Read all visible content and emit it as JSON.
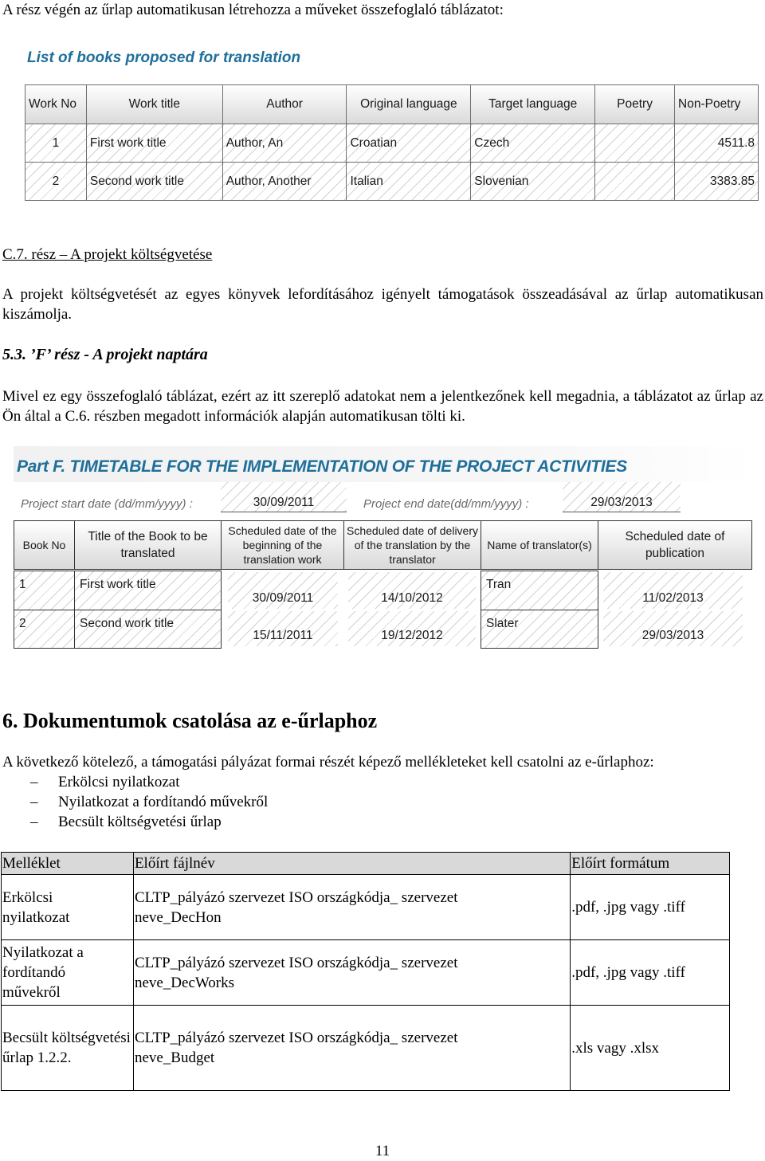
{
  "intro_line": "A rész végén az űrlap automatikusan létrehozza a műveket összefoglaló táblázatot:",
  "books_table": {
    "title": "List of books proposed for translation",
    "headers": [
      "Work No",
      "Work title",
      "Author",
      "Original language",
      "Target language",
      "Poetry",
      "Non-Poetry"
    ],
    "rows": [
      [
        "1",
        "First work title",
        "Author, An",
        "Croatian",
        "Czech",
        "",
        "4511.8"
      ],
      [
        "2",
        "Second work title",
        "Author, Another",
        "Italian",
        "Slovenian",
        "",
        "3383.85"
      ]
    ]
  },
  "section_c7": {
    "heading": "C.7. rész – A projekt költségvetése",
    "paragraph": "A projekt költségvetését az egyes könyvek lefordításához igényelt támogatások összeadásával az űrlap automatikusan kiszámolja."
  },
  "section_53": {
    "heading": "5.3. ’F’ rész - A projekt naptára",
    "paragraph": "Mivel ez egy összefoglaló táblázat, ezért az itt szereplő adatokat nem a jelentkezőnek kell megadnia, a táblázatot az űrlap az Ön által a C.6. részben megadott információk alapján automatikusan tölti ki."
  },
  "timetable": {
    "title": "Part F. TIMETABLE FOR THE IMPLEMENTATION OF THE PROJECT ACTIVITIES",
    "start_label": "Project start date (dd/mm/yyyy) :",
    "start_value": "30/09/2011",
    "end_label": "Project end date(dd/mm/yyyy) :",
    "end_value": "29/03/2013",
    "headers": [
      "Book No",
      "Title of the Book to be translated",
      "Scheduled date of the beginning of the translation work",
      "Scheduled date of delivery of the translation by the translator",
      "Name of translator(s)",
      "Scheduled date of publication"
    ],
    "rows": [
      [
        "1",
        "First work title",
        "30/09/2011",
        "14/10/2012",
        "Tran",
        "11/02/2013"
      ],
      [
        "2",
        "Second work title",
        "15/11/2011",
        "19/12/2012",
        "Slater",
        "29/03/2013"
      ]
    ]
  },
  "section_6": {
    "heading": "6. Dokumentumok csatolása az e-űrlaphoz",
    "paragraph": "A következő kötelező, a támogatási pályázat formai részét képező mellékleteket kell csatolni az e-űrlaphoz:",
    "bullet_marker": "–",
    "bullets": [
      "Erkölcsi nyilatkozat",
      "Nyilatkozat a fordítandó művekről",
      "Becsült költségvetési űrlap"
    ]
  },
  "attachments_table": {
    "headers": [
      "Melléklet",
      "Előírt fájlnév",
      "Előírt formátum"
    ],
    "rows": [
      [
        "Erkölcsi nyilatkozat",
        "CLTP_pályázó szervezet ISO országkódja_ szervezet neve_DecHon",
        ".pdf, .jpg vagy .tiff"
      ],
      [
        "Nyilatkozat a fordítandó művekről",
        "CLTP_pályázó szervezet ISO országkódja_ szervezet neve_DecWorks",
        ".pdf, .jpg vagy .tiff"
      ],
      [
        "Becsült költségvetési űrlap 1.2.2.",
        "CLTP_pályázó szervezet ISO országkódja_ szervezet neve_Budget",
        ".xls vagy .xlsx"
      ]
    ]
  },
  "page_number": "11",
  "colors": {
    "form_title_blue": "#1e6f9a",
    "label_gray": "#6a6a6a",
    "table_header_gray": "#d9d9d9"
  }
}
